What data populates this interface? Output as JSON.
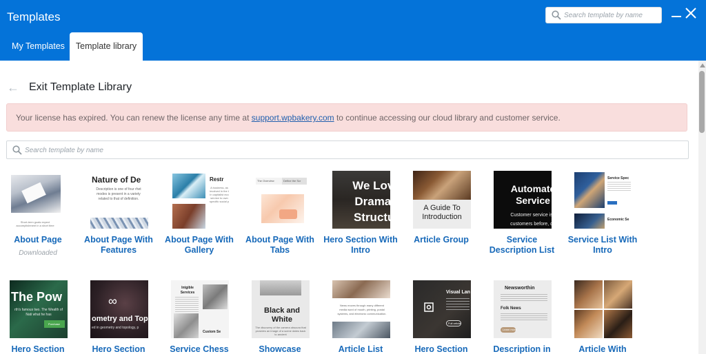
{
  "app": {
    "title": "Templates",
    "search_placeholder": "Search template by name"
  },
  "tabs": [
    {
      "label": "My Templates",
      "active": false
    },
    {
      "label": "Template library",
      "active": true
    }
  ],
  "library": {
    "exit_label": "Exit Template Library",
    "notice_prefix": "Your license has expired. You can renew the license any time at ",
    "notice_link": "support.wpbakery.com",
    "notice_suffix": " to continue accessing our cloud library and customer service.",
    "search_placeholder": "Search template by name"
  },
  "thumb_text": {
    "t1": "Short-term goals expect accomplishment in a short time",
    "t2_title": "Nature of De",
    "t2_body": "Description is one of four rhet modes is present in a variety related to that of definition.",
    "t3_title": "Restr",
    "t3_body": "A business, as involved in the t In capitalist eco service to own specific social p",
    "t4_tab1": "The Overview",
    "t4_tab2": "Define the Scr",
    "t5": "We Love Dramati Structur",
    "t6": "A Guide To Introduction",
    "t7_title": "Automate Service",
    "t7_body": "Customer service is t customers before, du",
    "t8_a": "Service Spec",
    "t8_b": "Economic Se",
    "t9_title": "The Pow",
    "t9_body": "rth's famous two. The Wealth of Nati what he has",
    "t9_btn": "Purchase",
    "t10_title": "ometry and Topol",
    "t10_body": "ed in geometry and topology, p",
    "t11_title": "Intgible Services",
    "t11_b": "Custom Se",
    "t12": "Black and White",
    "t12_body": "The discovery of the camera obscura that provides an image of a scene dates back to ancient",
    "t13": "News moves through many different media word of mouth, printing, postal systems, and electronic communication.",
    "t14_title": "Visual Lan",
    "t14_btn": "Full article",
    "t15_title": "Newsworthin",
    "t15_sub": "Folk News",
    "t15_btn": "Learn more"
  },
  "templates": [
    {
      "title": "About Page",
      "sub": "Downloaded"
    },
    {
      "title": "About Page With Features",
      "sub": ""
    },
    {
      "title": "About Page With Gallery",
      "sub": ""
    },
    {
      "title": "About Page With Tabs",
      "sub": ""
    },
    {
      "title": "Hero Section With Intro",
      "sub": ""
    },
    {
      "title": "Article Group",
      "sub": ""
    },
    {
      "title": "Service Description List",
      "sub": ""
    },
    {
      "title": "Service List With Intro",
      "sub": ""
    },
    {
      "title": "Hero Section",
      "sub": ""
    },
    {
      "title": "Hero Section",
      "sub": ""
    },
    {
      "title": "Service Chess",
      "sub": ""
    },
    {
      "title": "Showcase",
      "sub": ""
    },
    {
      "title": "Article List",
      "sub": ""
    },
    {
      "title": "Hero Section",
      "sub": ""
    },
    {
      "title": "Description in",
      "sub": ""
    },
    {
      "title": "Article With",
      "sub": ""
    }
  ],
  "colors": {
    "header": "#0473d9",
    "title_link": "#1769b9",
    "notice_bg": "#f9dedd"
  }
}
